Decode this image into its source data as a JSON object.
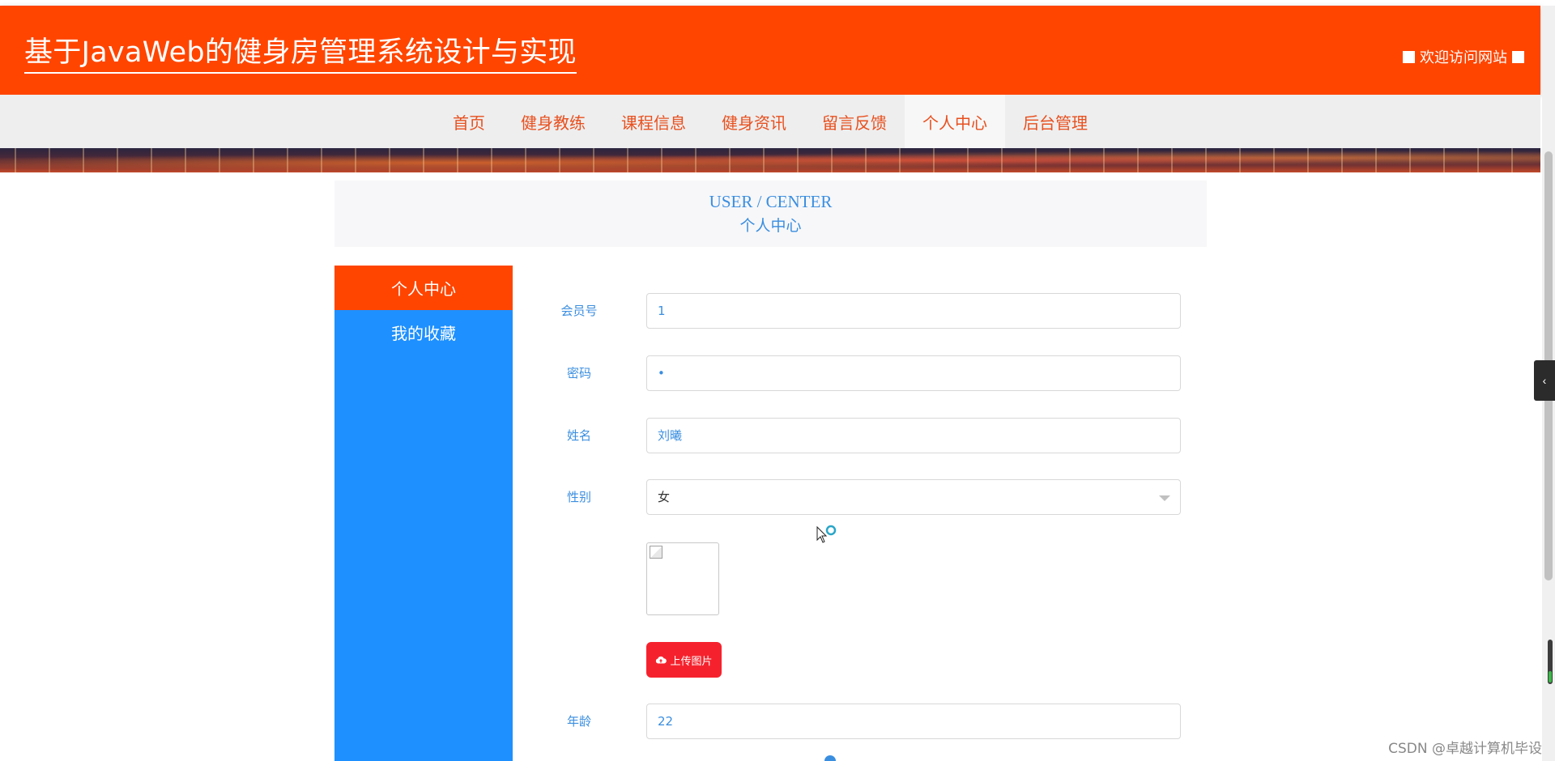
{
  "header": {
    "site_title": "基于JavaWeb的健身房管理系统设计与实现",
    "welcome_text": "欢迎访问网站",
    "background_color": "#ff4500"
  },
  "nav": {
    "items": [
      {
        "label": "首页"
      },
      {
        "label": "健身教练"
      },
      {
        "label": "课程信息"
      },
      {
        "label": "健身资讯"
      },
      {
        "label": "留言反馈"
      },
      {
        "label": "个人中心",
        "active": true
      },
      {
        "label": "后台管理"
      }
    ]
  },
  "page_head": {
    "title_en": "USER / CENTER",
    "title_cn": "个人中心"
  },
  "sidebar": {
    "background_color": "#1e90ff",
    "active_color": "#ff4500",
    "items": [
      {
        "label": "个人中心",
        "active": true
      },
      {
        "label": "我的收藏",
        "active": false
      }
    ]
  },
  "form": {
    "member_no": {
      "label": "会员号",
      "value": "1"
    },
    "password": {
      "label": "密码",
      "value": "•"
    },
    "name": {
      "label": "姓名",
      "value": "刘曦"
    },
    "gender": {
      "label": "性别",
      "value": "女"
    },
    "upload_button": {
      "label": "上传图片",
      "icon": "cloud-upload-icon",
      "color": "#f5222d"
    },
    "age": {
      "label": "年龄",
      "value": "22"
    }
  },
  "watermark": "CSDN @卓越计算机毕设"
}
